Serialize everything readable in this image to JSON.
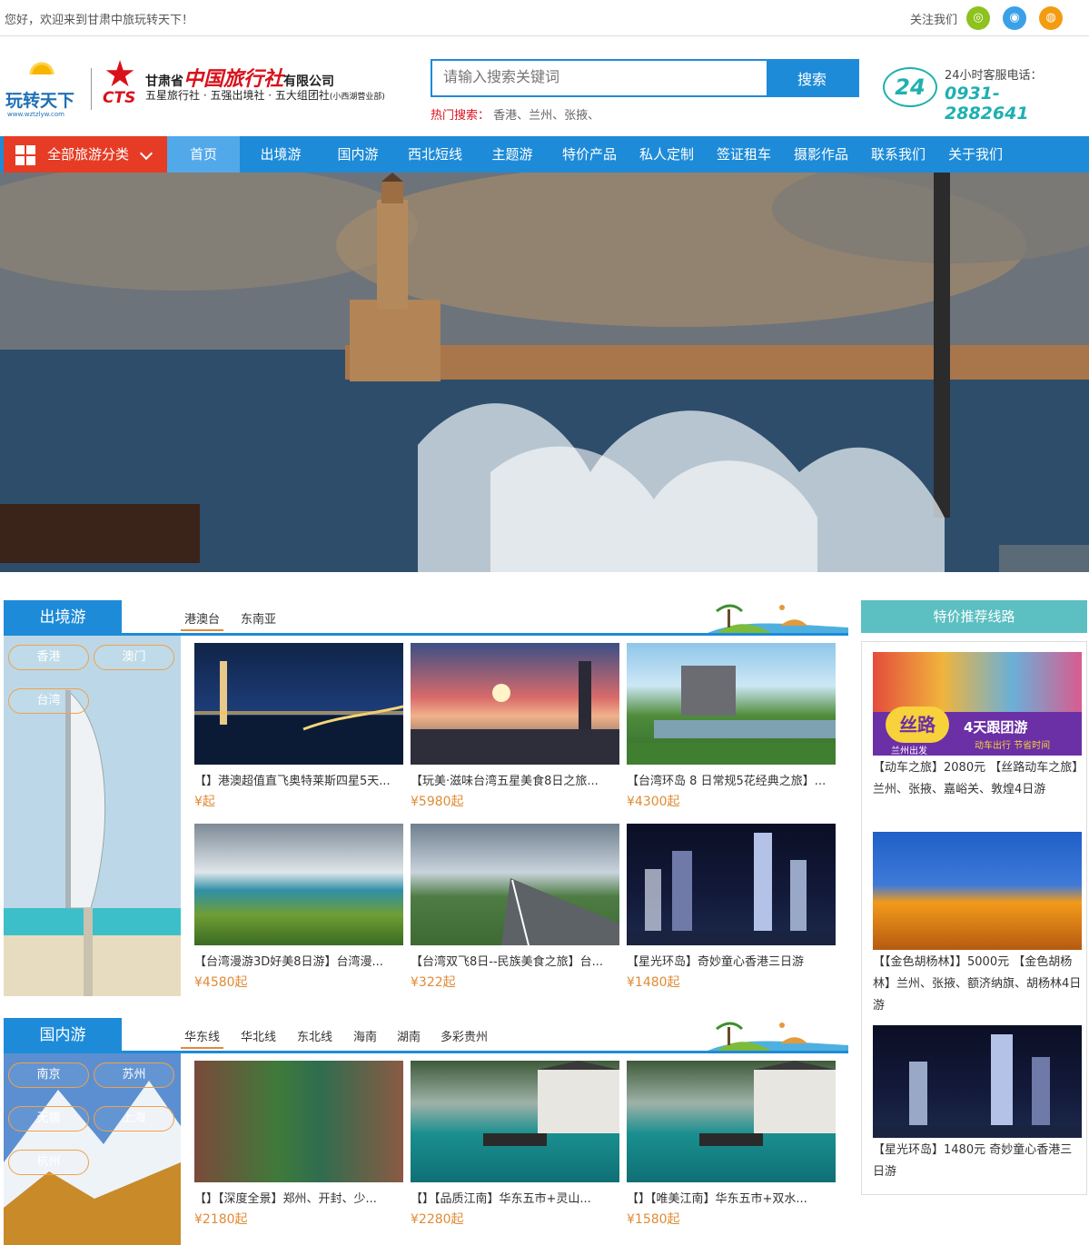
{
  "topbar": {
    "welcome": "您好，欢迎来到甘肃中旅玩转天下！",
    "follow_label": "关注我们",
    "socials": [
      {
        "icon": "weibo-icon",
        "glyph": "◎",
        "color": "#8dc21f"
      },
      {
        "icon": "tencent-weibo-icon",
        "glyph": "◉",
        "color": "#3aa1e8"
      },
      {
        "icon": "wechat-icon",
        "glyph": "◍",
        "color": "#f39c12"
      }
    ]
  },
  "logo": {
    "name": "玩转天下",
    "url": "www.wztzlyw.com"
  },
  "cts": {
    "abbr": "CTS",
    "name_pre": "甘肃省",
    "name_red": "中国旅行社",
    "name_post": "有限公司",
    "subtitle": "五星旅行社 · 五强出境社 · 五大组团社",
    "branch": "(小西湖营业部)"
  },
  "search": {
    "placeholder": "请输入搜索关键词",
    "button": "搜索",
    "hot_label": "热门搜索：",
    "hot_terms": "香港、兰州、张掖、"
  },
  "hotline": {
    "badge": "24",
    "label": "24小时客服电话：",
    "number": "0931-2882641"
  },
  "nav": {
    "all_categories": "全部旅游分类",
    "items": [
      "首页",
      "出境游",
      "国内游",
      "西北短线",
      "主题游",
      "特价产品",
      "私人定制",
      "签证租车",
      "摄影作品",
      "联系我们",
      "关于我们"
    ]
  },
  "outbound": {
    "title": "出境游",
    "tabs": [
      "港澳台",
      "东南亚"
    ],
    "pills": [
      "香港",
      "澳门",
      "台湾"
    ],
    "cards": [
      {
        "caption": "【】港澳超值直飞奥特莱斯四星5天...",
        "price": "¥起"
      },
      {
        "caption": "【玩美·滋味台湾五星美食8日之旅...",
        "price": "¥5980起"
      },
      {
        "caption": "【台湾环岛 8 日常规5花经典之旅】...",
        "price": "¥4300起"
      },
      {
        "caption": "【台湾漫游3D好美8日游】台湾漫...",
        "price": "¥4580起"
      },
      {
        "caption": "【台湾双飞8日--民族美食之旅】台...",
        "price": "¥322起"
      },
      {
        "caption": "【星光环岛】奇妙童心香港三日游",
        "price": "¥1480起"
      }
    ]
  },
  "domestic": {
    "title": "国内游",
    "tabs": [
      "华东线",
      "华北线",
      "东北线",
      "海南",
      "湖南",
      "多彩贵州"
    ],
    "pills": [
      "南京",
      "苏州",
      "无锡",
      "上海",
      "杭州"
    ],
    "cards": [
      {
        "caption": "【】【深度全景】郑州、开封、少...",
        "price": "¥2180起"
      },
      {
        "caption": "【】【品质江南】华东五市+灵山...",
        "price": "¥2280起"
      },
      {
        "caption": "【】【唯美江南】华东五市+双水...",
        "price": "¥1580起"
      }
    ]
  },
  "special": {
    "title": "特价推荐线路",
    "promo_title": "丝路",
    "promo_sub": "兰州出发",
    "promo_tag": "4天跟团游",
    "promo_tag2": "动车出行 节省时间",
    "items": [
      {
        "caption": "【动车之旅】2080元 【丝路动车之旅】兰州、张掖、嘉峪关、敦煌4日游"
      },
      {
        "caption": "【【金色胡杨林】】5000元 【金色胡杨林】兰州、张掖、额济纳旗、胡杨林4日游"
      },
      {
        "caption": "【星光环岛】1480元 奇妙童心香港三日游"
      }
    ]
  }
}
